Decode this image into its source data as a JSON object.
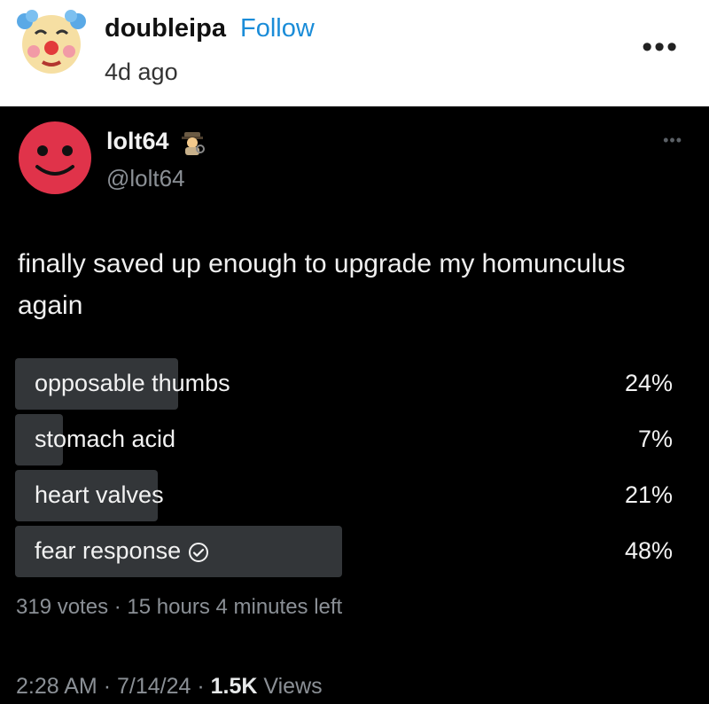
{
  "post": {
    "author": "doubleipa",
    "follow_label": "Follow",
    "time_ago": "4d ago",
    "avatar_icon": "clown-face-icon",
    "more_icon": "more-dots-icon"
  },
  "tweet": {
    "display_name": "lolt64",
    "name_emoji": "detective-icon",
    "handle": "@lolt64",
    "avatar_icon": "smiley-face-icon",
    "text": "finally saved up enough to upgrade my homunculus again",
    "poll": {
      "options": [
        {
          "label": "opposable thumbs",
          "percent_text": "24%",
          "percent": 24,
          "winner": false
        },
        {
          "label": "stomach acid",
          "percent_text": "7%",
          "percent": 7,
          "winner": false
        },
        {
          "label": "heart valves",
          "percent_text": "21%",
          "percent": 21,
          "winner": false
        },
        {
          "label": "fear response",
          "percent_text": "48%",
          "percent": 48,
          "winner": true
        }
      ],
      "votes": "319 votes",
      "time_left": "15 hours 4 minutes left"
    },
    "footer": {
      "time": "2:28 AM",
      "date": "7/14/24",
      "views_count": "1.5K",
      "views_label": "Views"
    }
  },
  "colors": {
    "follow": "#1a8cd8",
    "poll_bar": "#333639",
    "avatar_red": "#e0334a"
  }
}
